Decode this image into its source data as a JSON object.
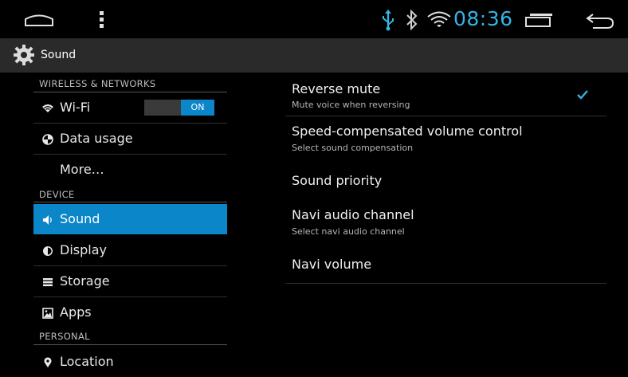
{
  "statusbar": {
    "time": "08:36",
    "accent": "#33b5e5",
    "icons": [
      "home-icon",
      "menu-icon",
      "usb-icon",
      "bluetooth-icon",
      "wifi-icon",
      "recent-apps-icon",
      "back-icon"
    ]
  },
  "actionbar": {
    "title": "Sound",
    "icon": "settings-gear-icon"
  },
  "sidebar": {
    "sections": {
      "wireless": "WIRELESS & NETWORKS",
      "device": "DEVICE",
      "personal": "PERSONAL"
    },
    "items": [
      {
        "label": "Wi-Fi",
        "icon": "wifi-icon",
        "toggle": "ON"
      },
      {
        "label": "Data usage",
        "icon": "data-usage-icon"
      },
      {
        "label": "More…"
      },
      {
        "label": "Sound",
        "icon": "speaker-icon",
        "selected": true
      },
      {
        "label": "Display",
        "icon": "display-icon"
      },
      {
        "label": "Storage",
        "icon": "storage-icon"
      },
      {
        "label": "Apps",
        "icon": "apps-icon"
      },
      {
        "label": "Location",
        "icon": "location-icon"
      }
    ],
    "selected_color": "#0b86c8"
  },
  "main": {
    "prefs": [
      {
        "title": "Reverse mute",
        "summary": "Mute voice when reversing",
        "checked": true
      },
      {
        "title": "Speed-compensated volume control",
        "summary": "Select sound compensation"
      },
      {
        "title": "Sound priority"
      },
      {
        "title": "Navi audio channel",
        "summary": "Select navi audio channel"
      },
      {
        "title": "Navi volume"
      }
    ]
  }
}
